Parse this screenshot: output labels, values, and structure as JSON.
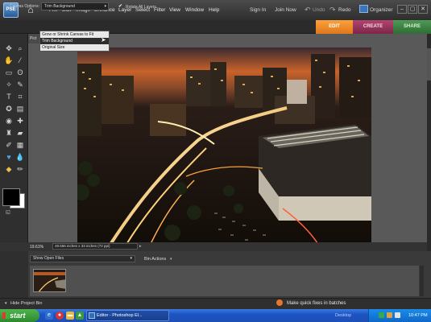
{
  "app": {
    "logo_text": "PSE"
  },
  "menu": [
    "File",
    "Edit",
    "Image",
    "Enhance",
    "Layer",
    "Select",
    "Filter",
    "View",
    "Window",
    "Help"
  ],
  "topbar": {
    "sign_in": "Sign In",
    "join_now": "Join Now",
    "undo": "Undo",
    "redo": "Redo",
    "organizer": "Organizer"
  },
  "mode_tabs": {
    "edit": "EDIT",
    "create": "CREATE",
    "share": "SHARE"
  },
  "options_bar": {
    "canvas_options_label": "Canvas Options:",
    "canvas_options_value": "Trim Background",
    "rotate_all_layers": "Rotate All Layers",
    "rotate_all_layers_checked": true
  },
  "canvas_dropdown": {
    "options": [
      "Grow or Shrink Canvas to Fit",
      "Trim Background",
      "Original Size"
    ],
    "selected_index": 1
  },
  "document": {
    "tab_label": "Pict",
    "zoom": "19.61%",
    "size": "49.556 inches x 33 inches (72 ppi)"
  },
  "project_bin": {
    "show_label": "Show Open Files",
    "actions_label": "Bin Actions",
    "hide_label": "Hide Project Bin"
  },
  "status": {
    "quick_fix": "Make quick fixes in batches"
  },
  "taskbar": {
    "start": "start",
    "task_item": "Editor - Photoshop El...",
    "desktop": "Desktop",
    "clock": "10:47 PM"
  },
  "colors": {
    "edit_tab": "#f08a2a",
    "create_tab": "#9a3560",
    "share_tab": "#3f8845",
    "foreground": "#000000",
    "background": "#ffffff"
  }
}
